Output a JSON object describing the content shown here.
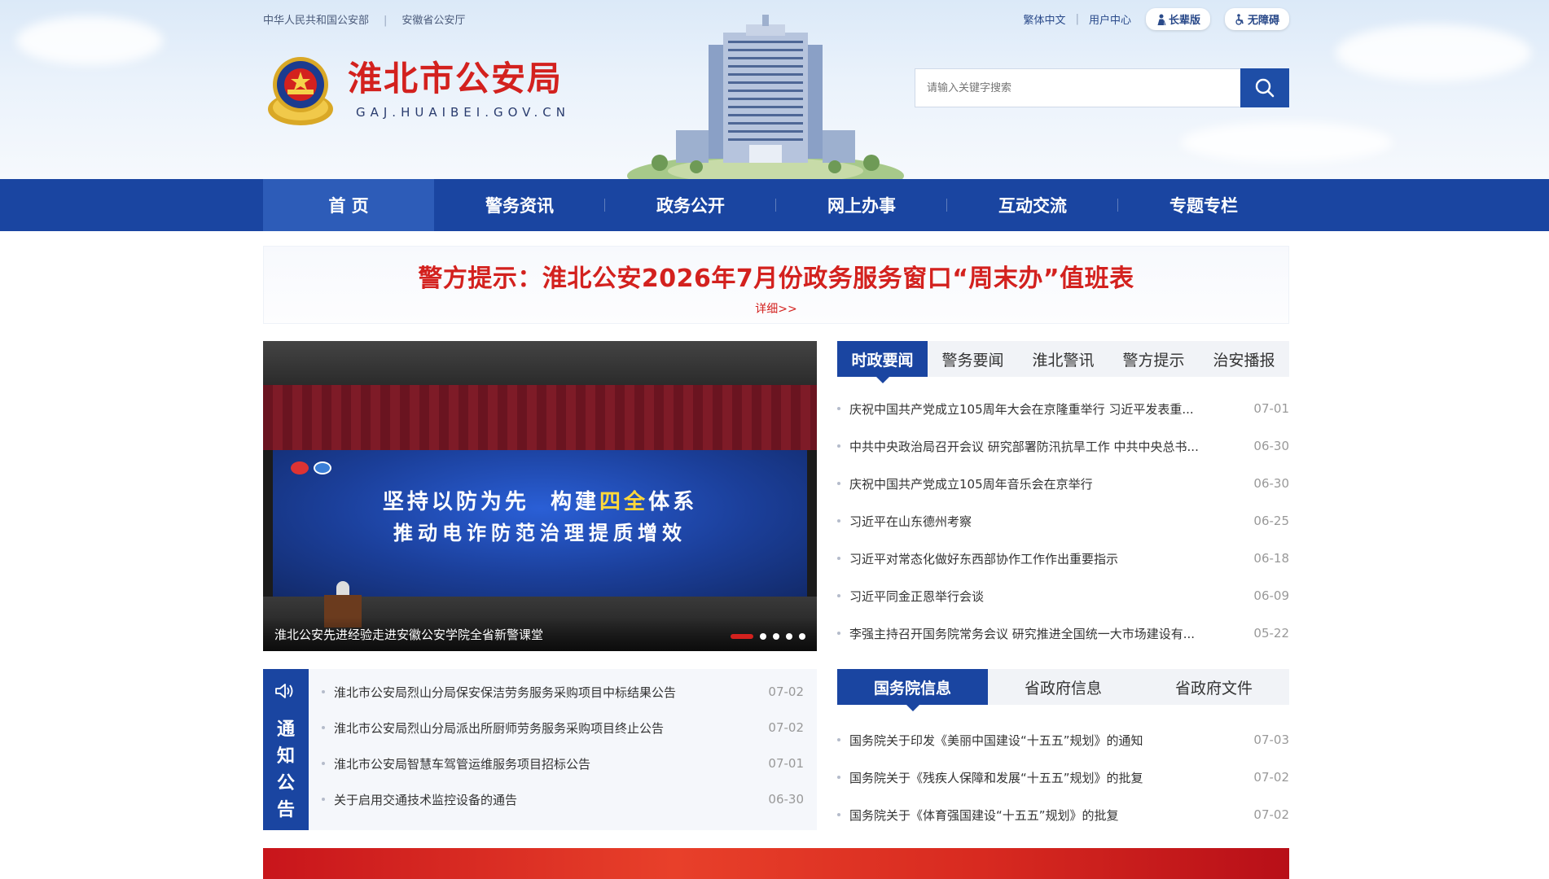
{
  "header": {
    "top_links": [
      "中华人民共和国公安部",
      "安徽省公安厅"
    ],
    "right_links": [
      "繁体中文",
      "用户中心"
    ],
    "elder_btn": "长辈版",
    "access_btn": "无障碍",
    "logo_cn": "淮北市公安局",
    "logo_en": "GAJ.HUAIBEI.GOV.CN"
  },
  "search": {
    "placeholder": "请输入关键字搜索"
  },
  "nav": [
    "首 页",
    "警务资讯",
    "政务公开",
    "网上办事",
    "互动交流",
    "专题专栏"
  ],
  "alert": {
    "title": "警方提示：淮北公安2026年7月份政务服务窗口“周末办”值班表",
    "more": "详细>>"
  },
  "slider": {
    "screen_line1a": "坚持以防为先",
    "screen_line1b": "构建",
    "screen_line1c": "四全",
    "screen_line1d": "体系",
    "screen_line2": "推动电诈防范治理提质增效",
    "caption": "淮北公安先进经验走进安徽公安学院全省新警课堂"
  },
  "news_tabs": [
    "时政要闻",
    "警务要闻",
    "淮北警讯",
    "警方提示",
    "治安播报"
  ],
  "news": [
    {
      "title": "庆祝中国共产党成立105周年大会在京隆重举行 习近平发表重...",
      "date": "07-01"
    },
    {
      "title": "中共中央政治局召开会议 研究部署防汛抗旱工作 中共中央总书...",
      "date": "06-30"
    },
    {
      "title": "庆祝中国共产党成立105周年音乐会在京举行",
      "date": "06-30"
    },
    {
      "title": "习近平在山东德州考察",
      "date": "06-25"
    },
    {
      "title": "习近平对常态化做好东西部协作工作作出重要指示",
      "date": "06-18"
    },
    {
      "title": "习近平同金正恩举行会谈",
      "date": "06-09"
    },
    {
      "title": "李强主持召开国务院常务会议 研究推进全国统一大市场建设有...",
      "date": "05-22"
    }
  ],
  "notice": {
    "label": [
      "通",
      "知",
      "公",
      "告"
    ],
    "items": [
      {
        "title": "淮北市公安局烈山分局保安保洁劳务服务采购项目中标结果公告",
        "date": "07-02"
      },
      {
        "title": "淮北市公安局烈山分局派出所厨师劳务服务采购项目终止公告",
        "date": "07-02"
      },
      {
        "title": "淮北市公安局智慧车驾管运维服务项目招标公告",
        "date": "07-01"
      },
      {
        "title": "关于启用交通技术监控设备的通告",
        "date": "06-30"
      }
    ]
  },
  "gov_tabs": [
    "国务院信息",
    "省政府信息",
    "省政府文件"
  ],
  "gov_news": [
    {
      "title": "国务院关于印发《美丽中国建设“十五五”规划》的通知",
      "date": "07-03"
    },
    {
      "title": "国务院关于《残疾人保障和发展“十五五”规划》的批复",
      "date": "07-02"
    },
    {
      "title": "国务院关于《体育强国建设“十五五”规划》的批复",
      "date": "07-02"
    }
  ],
  "colors": {
    "primary": "#1a45a1",
    "accent": "#d3211e"
  }
}
